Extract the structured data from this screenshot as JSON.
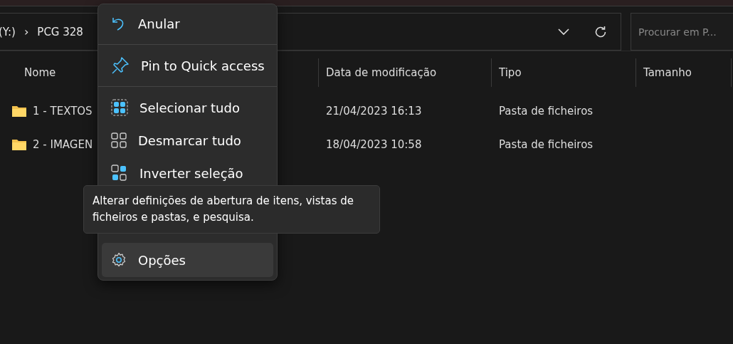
{
  "address_bar": {
    "crumbs": [
      "(Y:)",
      "PCG 328"
    ],
    "separator": "›"
  },
  "search": {
    "placeholder": "Procurar em P..."
  },
  "table": {
    "columns": [
      "Nome",
      "Data de modificação",
      "Tipo",
      "Tamanho"
    ],
    "rows": [
      {
        "name": "1 - TEXTOS",
        "modified": "21/04/2023 16:13",
        "type": "Pasta de ficheiros"
      },
      {
        "name": "2 - IMAGEN",
        "modified": "18/04/2023 10:58",
        "type": "Pasta de ficheiros"
      }
    ]
  },
  "menu": {
    "items": [
      {
        "kind": "undo",
        "label": "Anular",
        "selected": false
      },
      {
        "kind": "divider"
      },
      {
        "kind": "pin",
        "label": "Pin to Quick access",
        "selected": false
      },
      {
        "kind": "divider"
      },
      {
        "kind": "select-all",
        "label": "Selecionar tudo",
        "selected": false
      },
      {
        "kind": "select-none",
        "label": "Desmarcar tudo",
        "selected": false
      },
      {
        "kind": "invert",
        "label": "Inverter seleção",
        "selected": false
      },
      {
        "kind": "gap"
      },
      {
        "kind": "options",
        "label": "Opções",
        "selected": true
      }
    ]
  },
  "tooltip": {
    "text": "Alterar definições de abertura de itens, vistas de ficheiros e pastas, e pesquisa."
  }
}
